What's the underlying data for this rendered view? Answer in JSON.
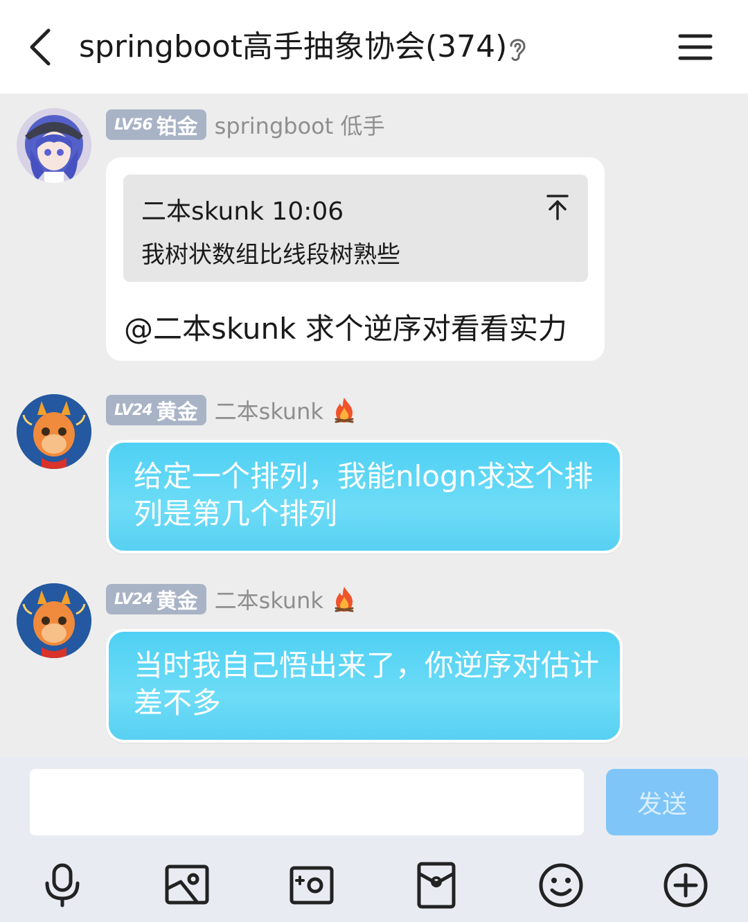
{
  "header": {
    "title": "springboot高手抽象协会(374)",
    "back_icon": "chevron-left-icon",
    "ear_icon": "ear-icon",
    "menu_icon": "hamburger-menu-icon"
  },
  "messages": [
    {
      "level": "LV56",
      "rank": "铂金",
      "nickname": "springboot 低手",
      "quote": {
        "author_time": "二本skunk 10:06",
        "text": "我树状数组比线段树熟些"
      },
      "text": "@二本skunk 求个逆序对看看实力"
    },
    {
      "level": "LV24",
      "rank": "黄金",
      "nickname": "二本skunk",
      "text": "给定一个排列，我能nlogn求这个排列是第几个排列"
    },
    {
      "level": "LV24",
      "rank": "黄金",
      "nickname": "二本skunk",
      "text": "当时我自己悟出来了，你逆序对估计差不多"
    }
  ],
  "composer": {
    "input_value": "",
    "send_label": "发送",
    "tools": [
      "microphone-icon",
      "image-icon",
      "camera-icon",
      "red-envelope-icon",
      "emoji-icon",
      "plus-icon"
    ]
  },
  "colors": {
    "bubble_blue": "#5ed6f5",
    "badge": "#a9b3c6",
    "send_button": "#7fc5f7"
  }
}
